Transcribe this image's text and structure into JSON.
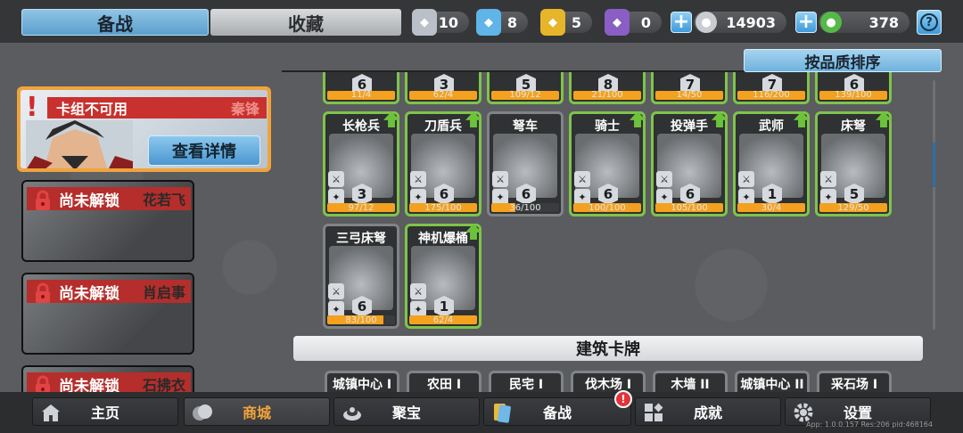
{
  "tabs": {
    "deck": "备战",
    "collection": "收藏"
  },
  "resources": [
    {
      "name": "silver-shield-icon",
      "value": "10",
      "color": "#b9c0c7"
    },
    {
      "name": "blue-crystal-icon",
      "value": "8",
      "color": "#5fb4e8"
    },
    {
      "name": "gold-shield-icon",
      "value": "5",
      "color": "#e7b52a"
    },
    {
      "name": "purple-shield-icon",
      "value": "0",
      "color": "#8a5ec4"
    }
  ],
  "coins": "14903",
  "gems": "378",
  "help": "?",
  "sort_label": "按品质排序",
  "hero_active": {
    "banner": "卡组不可用",
    "name": "秦锋",
    "detail_button": "查看详情"
  },
  "heroes_locked": [
    {
      "label": "尚未解锁",
      "name": "花若飞"
    },
    {
      "label": "尚未解锁",
      "name": "肖启事"
    },
    {
      "label": "尚未解锁",
      "name": "石拂衣"
    }
  ],
  "top_row": [
    {
      "lvl": "6",
      "count": "11/4"
    },
    {
      "lvl": "3",
      "count": "62/4"
    },
    {
      "lvl": "5",
      "count": "109/12"
    },
    {
      "lvl": "8",
      "count": "21/100"
    },
    {
      "lvl": "7",
      "count": "14/50"
    },
    {
      "lvl": "7",
      "count": "116/200"
    },
    {
      "lvl": "6",
      "count": "139/100"
    }
  ],
  "units_row1": [
    {
      "title": "长枪兵",
      "lvl": "3",
      "count": "97/12",
      "progress": 1.0,
      "upgrade": true
    },
    {
      "title": "刀盾兵",
      "lvl": "6",
      "count": "175/100",
      "progress": 1.0,
      "upgrade": true
    },
    {
      "title": "弩车",
      "lvl": "6",
      "count": "36/100",
      "progress": 0.36,
      "upgrade": false
    },
    {
      "title": "骑士",
      "lvl": "6",
      "count": "100/100",
      "progress": 1.0,
      "upgrade": true
    },
    {
      "title": "投弹手",
      "lvl": "6",
      "count": "105/100",
      "progress": 1.0,
      "upgrade": true
    },
    {
      "title": "武师",
      "lvl": "1",
      "count": "30/4",
      "progress": 1.0,
      "upgrade": true
    },
    {
      "title": "床弩",
      "lvl": "5",
      "count": "129/50",
      "progress": 1.0,
      "upgrade": true
    }
  ],
  "units_row2": [
    {
      "title": "三弓床弩",
      "lvl": "6",
      "count": "83/100",
      "progress": 0.83,
      "upgrade": false
    },
    {
      "title": "神机爆桶",
      "lvl": "1",
      "count": "62/4",
      "progress": 1.0,
      "upgrade": true
    }
  ],
  "building_section": "建筑卡牌",
  "buildings": [
    "城镇中心 I",
    "农田 I",
    "民宅 I",
    "伐木场 I",
    "木墙 II",
    "城镇中心 II",
    "采石场 I"
  ],
  "nav": [
    {
      "label": "主页",
      "icon": "home-icon"
    },
    {
      "label": "商城",
      "icon": "shop-coins-icon"
    },
    {
      "label": "聚宝",
      "icon": "treasure-icon"
    },
    {
      "label": "备战",
      "icon": "card-deck-icon"
    },
    {
      "label": "成就",
      "icon": "achievement-icon"
    },
    {
      "label": "设置",
      "icon": "gear-icon"
    }
  ],
  "nav_badge": "!",
  "version": "App: 1.0.0.157 Res:206 pid:468164"
}
